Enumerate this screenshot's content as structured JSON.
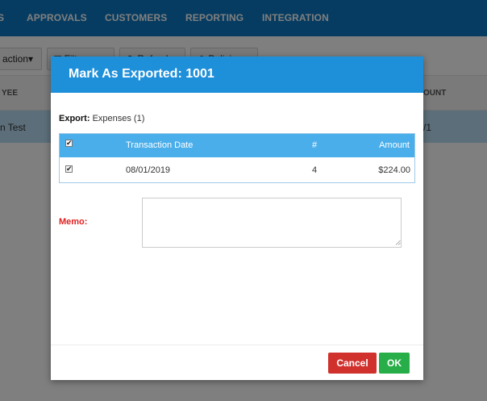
{
  "nav": {
    "items": [
      {
        "label": "S"
      },
      {
        "label": "APPROVALS"
      },
      {
        "label": "CUSTOMERS"
      },
      {
        "label": "REPORTING"
      },
      {
        "label": "INTEGRATION"
      }
    ]
  },
  "toolbar": {
    "action_label": "action▾",
    "filter_label": "▽ Filter",
    "refresh_label": "⟳ Refresh",
    "policies_label": "⊕ Policies"
  },
  "grid": {
    "header_left": "YEE",
    "header_right": "OUNT",
    "row_left": "n Test",
    "row_right": "/1"
  },
  "modal": {
    "title": "Mark As Exported: 1001",
    "export_label": "Export:",
    "export_value": "Expenses (1)",
    "table": {
      "columns": [
        "Transaction Date",
        "#",
        "Amount"
      ],
      "rows": [
        {
          "date": "08/01/2019",
          "number": "4",
          "amount": "$224.00"
        }
      ]
    },
    "memo_label": "Memo:",
    "memo_value": "",
    "cancel_label": "Cancel",
    "ok_label": "OK"
  },
  "colors": {
    "nav_bg": "#0d79c3",
    "modal_header": "#1e8fd9",
    "table_header": "#4aaeea",
    "cancel": "#d0312d",
    "ok": "#27ae48",
    "memo_label": "#e02020"
  }
}
